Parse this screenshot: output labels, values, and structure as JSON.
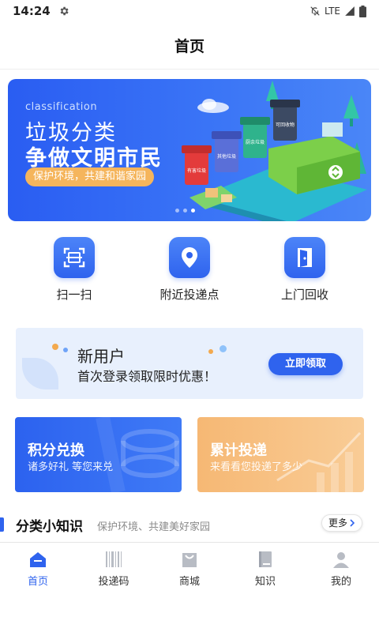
{
  "status_bar": {
    "time": "14:24",
    "network": "LTE"
  },
  "header": {
    "title": "首页"
  },
  "banner": {
    "subtitle_en": "classification",
    "line1": "垃圾分类",
    "line2": "争做文明市民",
    "tag": "保护环境，共建和谐家园",
    "bin_labels": [
      "有害垃圾",
      "其他垃圾",
      "厨余垃圾",
      "可回收物"
    ]
  },
  "quick_actions": [
    {
      "label": "扫一扫",
      "icon": "scan-icon"
    },
    {
      "label": "附近投递点",
      "icon": "location-pin-icon"
    },
    {
      "label": "上门回收",
      "icon": "door-icon"
    }
  ],
  "new_user": {
    "title": "新用户",
    "subtitle": "首次登录领取限时优惠！",
    "button": "立即领取"
  },
  "cards": {
    "points": {
      "title": "积分兑换",
      "subtitle": "诸多好礼 等您来兑"
    },
    "total": {
      "title": "累计投递",
      "subtitle": "来看看您投递了多少"
    }
  },
  "knowledge": {
    "title": "分类小知识",
    "subtitle": "保护环境、共建美好家园",
    "more": "更多"
  },
  "tabs": [
    {
      "label": "首页",
      "icon": "home-icon",
      "active": true
    },
    {
      "label": "投递码",
      "icon": "barcode-icon",
      "active": false
    },
    {
      "label": "商城",
      "icon": "shopping-bag-icon",
      "active": false
    },
    {
      "label": "知识",
      "icon": "book-icon",
      "active": false
    },
    {
      "label": "我的",
      "icon": "user-icon",
      "active": false
    }
  ],
  "colors": {
    "primary": "#2f63ee",
    "accent_orange": "#f5b55c",
    "tab_inactive": "#b8bcc4"
  }
}
